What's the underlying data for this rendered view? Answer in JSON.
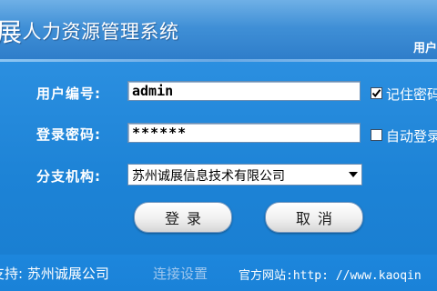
{
  "header": {
    "title_first_char": "展",
    "title_rest": "人力资源管理系统",
    "right_text": "用户"
  },
  "form": {
    "user_label": "用户编号:",
    "user_value": "admin",
    "password_label": "登录密码:",
    "password_value": "******",
    "branch_label": "分支机构:",
    "branch_selected": "苏州诚展信息技术有限公司",
    "remember_label": "记住密码",
    "remember_checked": true,
    "autologin_label": "自动登录",
    "autologin_checked": false
  },
  "buttons": {
    "login": "登录",
    "cancel": "取消"
  },
  "footer": {
    "support": "支持: 苏州诚展公司",
    "connect_settings": "连接设置",
    "website": "官方网站:http: //www.kaoqin"
  },
  "icons": {
    "dropdown": "dropdown-arrow-icon",
    "checkmark": "checkmark-icon"
  }
}
